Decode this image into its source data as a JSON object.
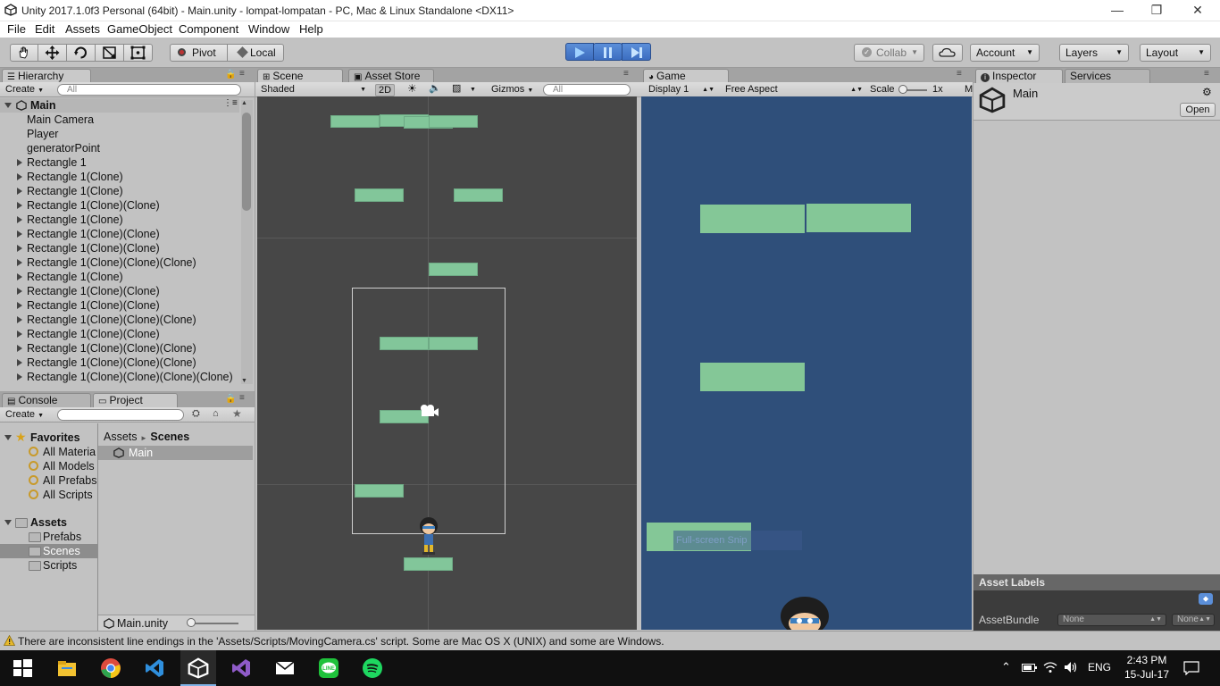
{
  "window": {
    "title": "Unity 2017.1.0f3 Personal (64bit) - Main.unity - lompat-lompatan - PC, Mac & Linux Standalone <DX11>",
    "minimize": "—",
    "restore": "❐",
    "close": "✕"
  },
  "menu": [
    "File",
    "Edit",
    "Assets",
    "GameObject",
    "Component",
    "Window",
    "Help"
  ],
  "toolbar": {
    "pivot": "Pivot",
    "local": "Local",
    "collab": "Collab",
    "account": "Account",
    "layers": "Layers",
    "layout": "Layout",
    "pivot_icon": "pivot-icon",
    "local_icon": "local-icon"
  },
  "hierarchy": {
    "tab": "Hierarchy",
    "create": "Create",
    "search_placeholder": "All",
    "scene": "Main",
    "items": [
      {
        "label": "Main Camera",
        "expandable": false
      },
      {
        "label": "Player",
        "expandable": false
      },
      {
        "label": "generatorPoint",
        "expandable": false
      },
      {
        "label": "Rectangle 1",
        "expandable": true
      },
      {
        "label": "Rectangle 1(Clone)",
        "expandable": true
      },
      {
        "label": "Rectangle 1(Clone)",
        "expandable": true
      },
      {
        "label": "Rectangle 1(Clone)(Clone)",
        "expandable": true
      },
      {
        "label": "Rectangle 1(Clone)",
        "expandable": true
      },
      {
        "label": "Rectangle 1(Clone)(Clone)",
        "expandable": true
      },
      {
        "label": "Rectangle 1(Clone)(Clone)",
        "expandable": true
      },
      {
        "label": "Rectangle 1(Clone)(Clone)(Clone)",
        "expandable": true
      },
      {
        "label": "Rectangle 1(Clone)",
        "expandable": true
      },
      {
        "label": "Rectangle 1(Clone)(Clone)",
        "expandable": true
      },
      {
        "label": "Rectangle 1(Clone)(Clone)",
        "expandable": true
      },
      {
        "label": "Rectangle 1(Clone)(Clone)(Clone)",
        "expandable": true
      },
      {
        "label": "Rectangle 1(Clone)(Clone)",
        "expandable": true
      },
      {
        "label": "Rectangle 1(Clone)(Clone)(Clone)",
        "expandable": true
      },
      {
        "label": "Rectangle 1(Clone)(Clone)(Clone)",
        "expandable": true
      },
      {
        "label": "Rectangle 1(Clone)(Clone)(Clone)(Clone)",
        "expandable": true
      }
    ]
  },
  "scene": {
    "tab": "Scene",
    "asset_store_tab": "Asset Store",
    "shading": "Shaded",
    "mode_2d": "2D",
    "gizmos": "Gizmos",
    "search_placeholder": "All"
  },
  "game": {
    "tab": "Game",
    "display": "Display 1",
    "aspect": "Free Aspect",
    "scale_label": "Scale",
    "scale_value": "1x",
    "maximize": "M",
    "overlay_text": "Full-screen Snip"
  },
  "inspector": {
    "tab": "Inspector",
    "services_tab": "Services",
    "object_name": "Main",
    "open_button": "Open",
    "asset_labels": "Asset Labels",
    "asset_bundle_label": "AssetBundle",
    "asset_bundle_value": "None",
    "asset_bundle_variant": "None"
  },
  "console": {
    "tab": "Console"
  },
  "project": {
    "tab": "Project",
    "create": "Create",
    "favorites_label": "Favorites",
    "favorites": [
      "All Materia",
      "All Models",
      "All Prefabs",
      "All Scripts"
    ],
    "assets_label": "Assets",
    "folders": [
      "Prefabs",
      "Scenes",
      "Scripts"
    ],
    "breadcrumb_root": "Assets",
    "breadcrumb_sep": "►",
    "breadcrumb_current": "Scenes",
    "files": [
      "Main"
    ],
    "selected_file": "Main.unity"
  },
  "status": {
    "message": "There are inconsistent line endings in the 'Assets/Scripts/MovingCamera.cs' script. Some are Mac OS X (UNIX) and some are Windows."
  },
  "taskbar": {
    "language": "ENG",
    "time": "2:43 PM",
    "date": "15-Jul-17",
    "apps": [
      "windows-start-icon",
      "file-explorer-icon",
      "chrome-icon",
      "vscode-icon",
      "unity-icon",
      "visual-studio-icon",
      "mail-icon",
      "line-icon",
      "spotify-icon"
    ]
  },
  "colors": {
    "platform": "#82c69a",
    "game_bg": "#2f4f7a",
    "scene_bg": "#474747",
    "play_active": "#3b6cbf"
  }
}
